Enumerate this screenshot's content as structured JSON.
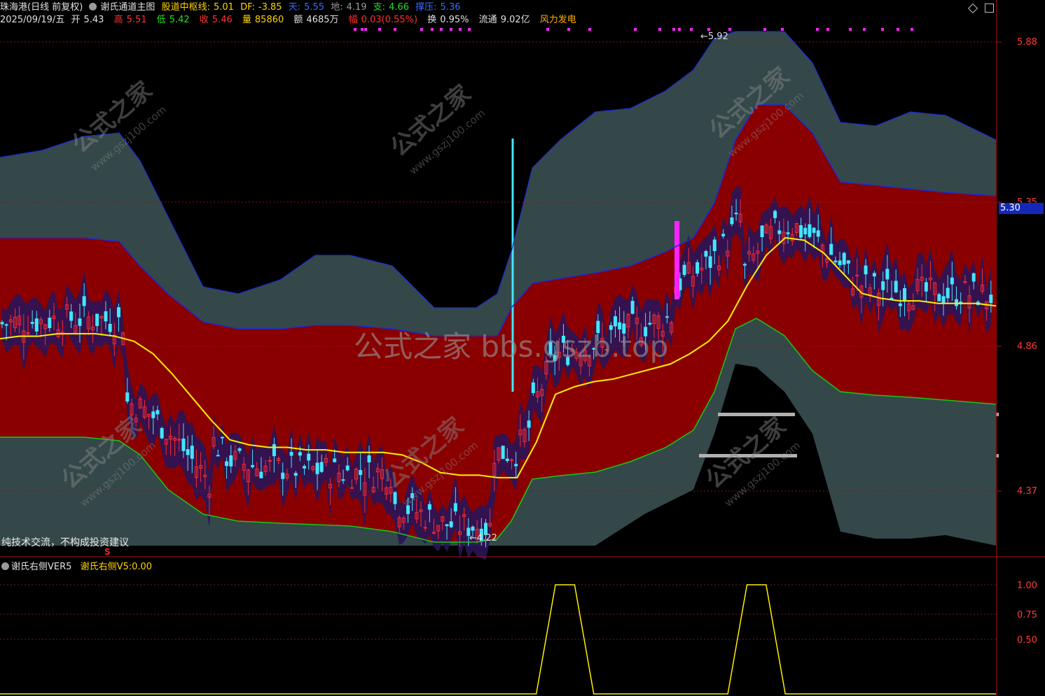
{
  "header": {
    "stock_name": "珠海港(日线 前复权)",
    "indicator_main": "谢氏通道主图",
    "zhongshu_label": "股道中枢线:",
    "zhongshu_value": "5.01",
    "df_label": "DF:",
    "df_value": "-3.85",
    "tian_label": "天:",
    "tian_value": "5.55",
    "di_label": "地:",
    "di_value": "4.19",
    "zhi_label": "支:",
    "zhi_value": "4.66",
    "ya_label": "撑压:",
    "ya_value": "5.36"
  },
  "quote": {
    "date": "2025/09/19/五",
    "open_label": "开",
    "open": "5.43",
    "high_label": "高",
    "high": "5.51",
    "low_label": "低",
    "low": "5.42",
    "close_label": "收",
    "close": "5.46",
    "volume_label": "量",
    "volume": "85860",
    "amount_label": "额",
    "amount": "4685万",
    "change_label": "幅",
    "change": "0.03(0.55%)",
    "turnover_label": "换",
    "turnover": "0.95%",
    "float_label": "流通",
    "float": "9.02亿",
    "concept": "风力发电"
  },
  "colors": {
    "outer_band": "#34484a",
    "inner_band": "#8a0000",
    "core_band": "#2a1458",
    "mid_line": "#ffee00",
    "up": "#ff2a2a",
    "down": "#44e6ff",
    "upper_edge": "#1a2bd8",
    "lower_edge": "#16c816"
  },
  "main_axis": {
    "ticks": [
      "5.88",
      "5.35",
      "4.86",
      "4.37"
    ],
    "current_price": "5.30"
  },
  "annotations": {
    "high_mark": "5.92",
    "low_mark": "4.22",
    "signal_mark": "S"
  },
  "watermarks": {
    "center": "公式之家 bbs.gszb.top",
    "name": "公式之家",
    "url": "www.gszj100.com"
  },
  "disclaimer": "纯技术交流，不构成投资建议",
  "sub_chart": {
    "indicator_name": "谢氏右侧VER5",
    "value_label": "谢氏右侧V5:",
    "value": "0.00",
    "ticks": [
      "1.00",
      "0.75",
      "0.50"
    ]
  },
  "chart_data": {
    "type": "line",
    "title": "谢氏通道主图",
    "y_range": [
      3.95,
      6.0
    ],
    "series": [
      {
        "name": "股道中枢线",
        "values": [
          4.88,
          4.89,
          4.89,
          4.9,
          4.9,
          4.9,
          4.89,
          4.87,
          4.82,
          4.74,
          4.65,
          4.56,
          4.48,
          4.46,
          4.45,
          4.45,
          4.44,
          4.44,
          4.43,
          4.43,
          4.43,
          4.42,
          4.39,
          4.35,
          4.34,
          4.34,
          4.33,
          4.33,
          4.47,
          4.66,
          4.69,
          4.71,
          4.72,
          4.74,
          4.76,
          4.78,
          4.82,
          4.87,
          4.95,
          5.09,
          5.21,
          5.28,
          5.27,
          5.22,
          5.14,
          5.06,
          5.04,
          5.03,
          5.03,
          5.02,
          5.02,
          5.02,
          5.01
        ]
      }
    ],
    "sub_series": {
      "name": "谢氏右侧V5",
      "values": [
        0,
        0,
        0,
        0,
        0,
        0,
        0,
        0,
        0,
        0,
        0,
        0,
        0,
        0,
        0,
        0,
        0,
        0,
        0,
        0,
        0,
        0,
        0,
        0,
        0,
        0,
        0,
        0,
        0,
        1,
        1,
        0,
        0,
        0,
        0,
        0,
        0,
        0,
        0,
        1,
        1,
        0,
        0,
        0,
        0,
        0,
        0,
        0,
        0,
        0,
        0,
        0,
        0
      ],
      "ylim": [
        0,
        1.1
      ]
    }
  }
}
